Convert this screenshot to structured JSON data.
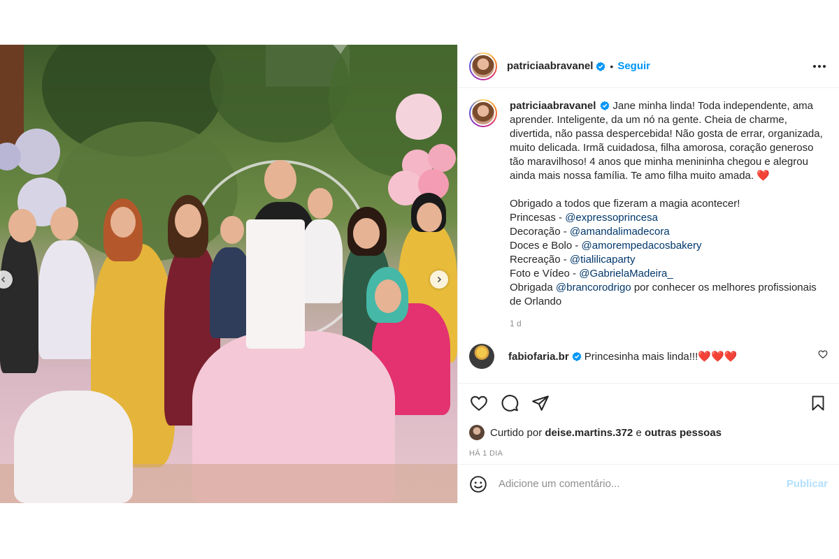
{
  "post": {
    "author": {
      "username": "patriciaabravanel",
      "verified": true,
      "follow_label": "Seguir",
      "separator": "•"
    },
    "photo": {
      "nav_prev_icon": "chevron-left-icon",
      "nav_next_icon": "chevron-right-icon"
    },
    "caption": {
      "username": "patriciaabravanel",
      "text_intro": "Jane minha linda! Toda independente, ama aprender. Inteligente, da um nó na gente. Cheia de charme, divertida, não passa despercebida! Não gosta de errar, organizada, muito delicada. Irmã cuidadosa, filha amorosa, coração generoso tão maravilhoso! 4 anos que minha menininha chegou e alegrou ainda mais nossa família. Te amo filha muito amada.",
      "heart": "❤️",
      "thanks_line": "Obrigado a todos que fizeram a magia acontecer!",
      "credits": [
        {
          "label": "Princesas - ",
          "mention": "@expressoprincesa"
        },
        {
          "label": "Decoração - ",
          "mention": "@amandalimadecora"
        },
        {
          "label": "Doces e Bolo - ",
          "mention": "@amorempedacosbakery"
        },
        {
          "label": "Recreação - ",
          "mention": "@tialilicaparty"
        },
        {
          "label": "Foto e Vídeo - ",
          "mention": "@GabrielaMadeira_"
        }
      ],
      "final_prefix": "Obrigada ",
      "final_mention": "@brancorodrigo",
      "final_suffix": " por conhecer os melhores profissionais de Orlando",
      "time_ago": "1 d"
    },
    "comments": [
      {
        "username": "fabiofaria.br",
        "verified": true,
        "text": "Princesinha mais linda!!!",
        "hearts": "❤️❤️❤️"
      }
    ],
    "likes": {
      "prefix": "Curtido por ",
      "user": "deise.martins.372",
      "middle": " e ",
      "others": "outras pessoas"
    },
    "date": "HÁ 1 DIA",
    "add_comment": {
      "placeholder": "Adicione um comentário...",
      "publish_label": "Publicar"
    },
    "colors": {
      "accent": "#0095f6",
      "publish_disabled": "#b2dffc",
      "mention": "#00376b",
      "heart": "#ed4956"
    }
  }
}
